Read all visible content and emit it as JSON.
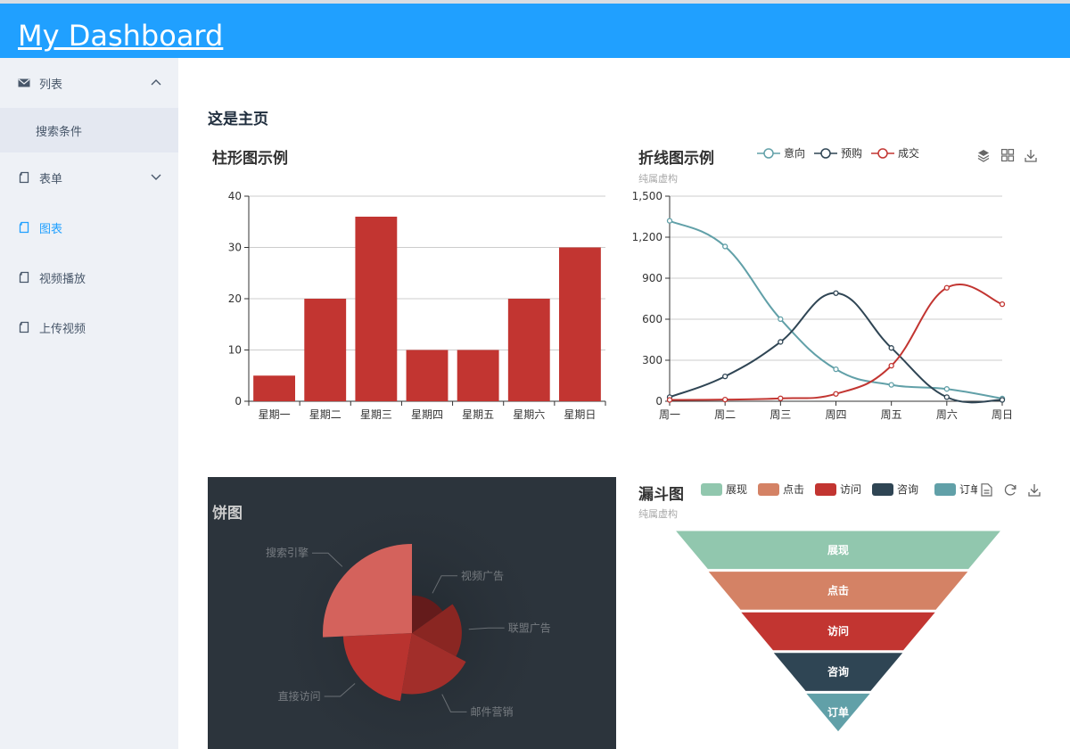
{
  "header": {
    "title": "My Dashboard"
  },
  "sidebar": {
    "items": [
      {
        "label": "列表",
        "icon": "envelope-icon",
        "expanded": true,
        "children": [
          {
            "label": "搜索条件"
          }
        ]
      },
      {
        "label": "表单",
        "icon": "document-icon",
        "expanded": false
      },
      {
        "label": "图表",
        "icon": "document-icon",
        "active": true
      },
      {
        "label": "视频播放",
        "icon": "document-icon"
      },
      {
        "label": "上传视频",
        "icon": "document-icon"
      }
    ]
  },
  "main": {
    "title": "这是主页"
  },
  "colors": {
    "bar": "#c23531",
    "line_series": [
      "#61a0a8",
      "#2f4554",
      "#c23531"
    ],
    "funnel": [
      "#91c7ae",
      "#d48265",
      "#c23531",
      "#2f4554",
      "#61a0a8"
    ],
    "pie_bg": "#2c343c"
  },
  "toolbar": {
    "line": [
      "layers-icon",
      "grid-icon",
      "download-icon"
    ],
    "funnel": [
      "document-icon",
      "refresh-icon",
      "download-icon"
    ]
  },
  "chart_data": [
    {
      "type": "bar",
      "title": "柱形图示例",
      "categories": [
        "星期一",
        "星期二",
        "星期三",
        "星期四",
        "星期五",
        "星期六",
        "星期日"
      ],
      "values": [
        5,
        20,
        36,
        10,
        10,
        20,
        30
      ],
      "ylim": [
        0,
        40
      ],
      "yticks": [
        "0",
        "10",
        "20",
        "30",
        "40"
      ],
      "grid": true
    },
    {
      "type": "line",
      "title": "折线图示例",
      "subtitle": "纯属虚构",
      "categories": [
        "周一",
        "周二",
        "周三",
        "周四",
        "周五",
        "周六",
        "周日"
      ],
      "series": [
        {
          "name": "意向",
          "values": [
            1320,
            1132,
            601,
            234,
            120,
            90,
            20
          ]
        },
        {
          "name": "预购",
          "values": [
            30,
            182,
            434,
            791,
            390,
            30,
            10
          ]
        },
        {
          "name": "成交",
          "values": [
            10,
            12,
            21,
            54,
            260,
            830,
            710
          ]
        }
      ],
      "ylim": [
        0,
        1500
      ],
      "yticks": [
        "0",
        "300",
        "600",
        "900",
        "1,200",
        "1,500"
      ],
      "legend": "top",
      "smooth": true
    },
    {
      "type": "pie",
      "title": "饼图",
      "roseType": "radius",
      "slices": [
        {
          "name": "视频广告",
          "value": 235,
          "color": "#641b1b"
        },
        {
          "name": "联盟广告",
          "value": 274,
          "color": "#8a2622"
        },
        {
          "name": "邮件营销",
          "value": 310,
          "color": "#a22e2a"
        },
        {
          "name": "直接访问",
          "value": 335,
          "color": "#b9332f"
        },
        {
          "name": "搜索引擎",
          "value": 400,
          "color": "#d4625c"
        }
      ]
    },
    {
      "type": "funnel",
      "title": "漏斗图",
      "subtitle": "纯属虚构",
      "categories": [
        "展现",
        "点击",
        "访问",
        "咨询",
        "订单"
      ],
      "values": [
        100,
        80,
        60,
        40,
        20
      ],
      "legend": "top"
    }
  ]
}
